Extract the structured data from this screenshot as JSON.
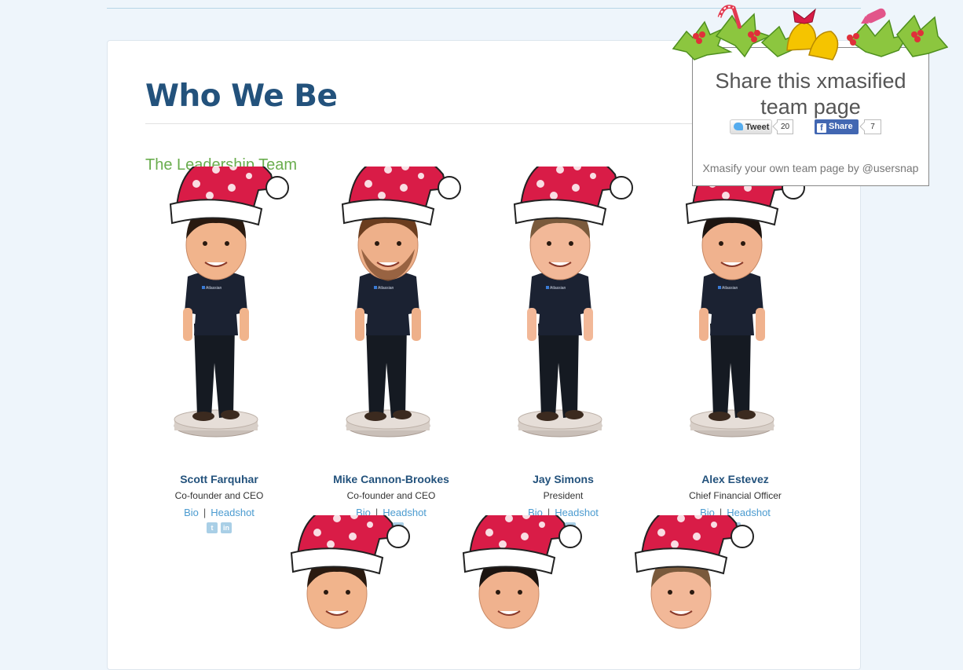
{
  "page": {
    "title": "Who We Be",
    "section_title": "The Leadership Team"
  },
  "team": [
    {
      "name": "Scott Farquhar",
      "role": "Co-founder and CEO",
      "bio": "Bio",
      "headshot": "Headshot",
      "social": [
        "twitter-icon",
        "linkedin-icon"
      ]
    },
    {
      "name": "Mike Cannon-Brookes",
      "role": "Co-founder and CEO",
      "bio": "Bio",
      "headshot": "Headshot",
      "social": [
        "twitter-icon",
        "rss-icon"
      ]
    },
    {
      "name": "Jay Simons",
      "role": "President",
      "bio": "Bio",
      "headshot": "Headshot",
      "social": [
        "twitter-icon",
        "linkedin-icon"
      ]
    },
    {
      "name": "Alex Estevez",
      "role": "Chief Financial Officer",
      "bio": "Bio",
      "headshot": "Headshot",
      "social": [
        "linkedin-icon"
      ]
    }
  ],
  "link_separator": "|",
  "shirt_logo": "Atlassian",
  "share": {
    "title": "Share this xmasified team page",
    "tweet_label": "Tweet",
    "tweet_count": "20",
    "fb_label": "Share",
    "fb_count": "7",
    "footer": "Xmasify your own team page by @usersnap"
  },
  "colors": {
    "title": "#23527c",
    "section": "#6aad4e",
    "link": "#4b9bd0",
    "hat": "#d91c47"
  }
}
